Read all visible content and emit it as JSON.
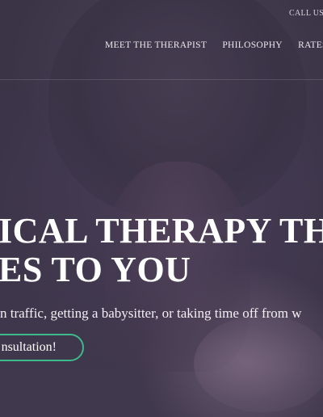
{
  "header": {
    "call_us": "CALL US:"
  },
  "nav": {
    "items": [
      {
        "label": "MEET THE THERAPIST"
      },
      {
        "label": "PHILOSOPHY"
      },
      {
        "label": "RATES"
      }
    ]
  },
  "hero": {
    "headline_line1": "ICAL THERAPY TH",
    "headline_line2": "ES TO YOU",
    "subtext": "n traffic, getting a babysitter, or taking time off from w",
    "cta_label": "nsultation!"
  },
  "colors": {
    "background": "#3c3448",
    "cta_border": "#3fb88c",
    "text": "#ffffff"
  }
}
